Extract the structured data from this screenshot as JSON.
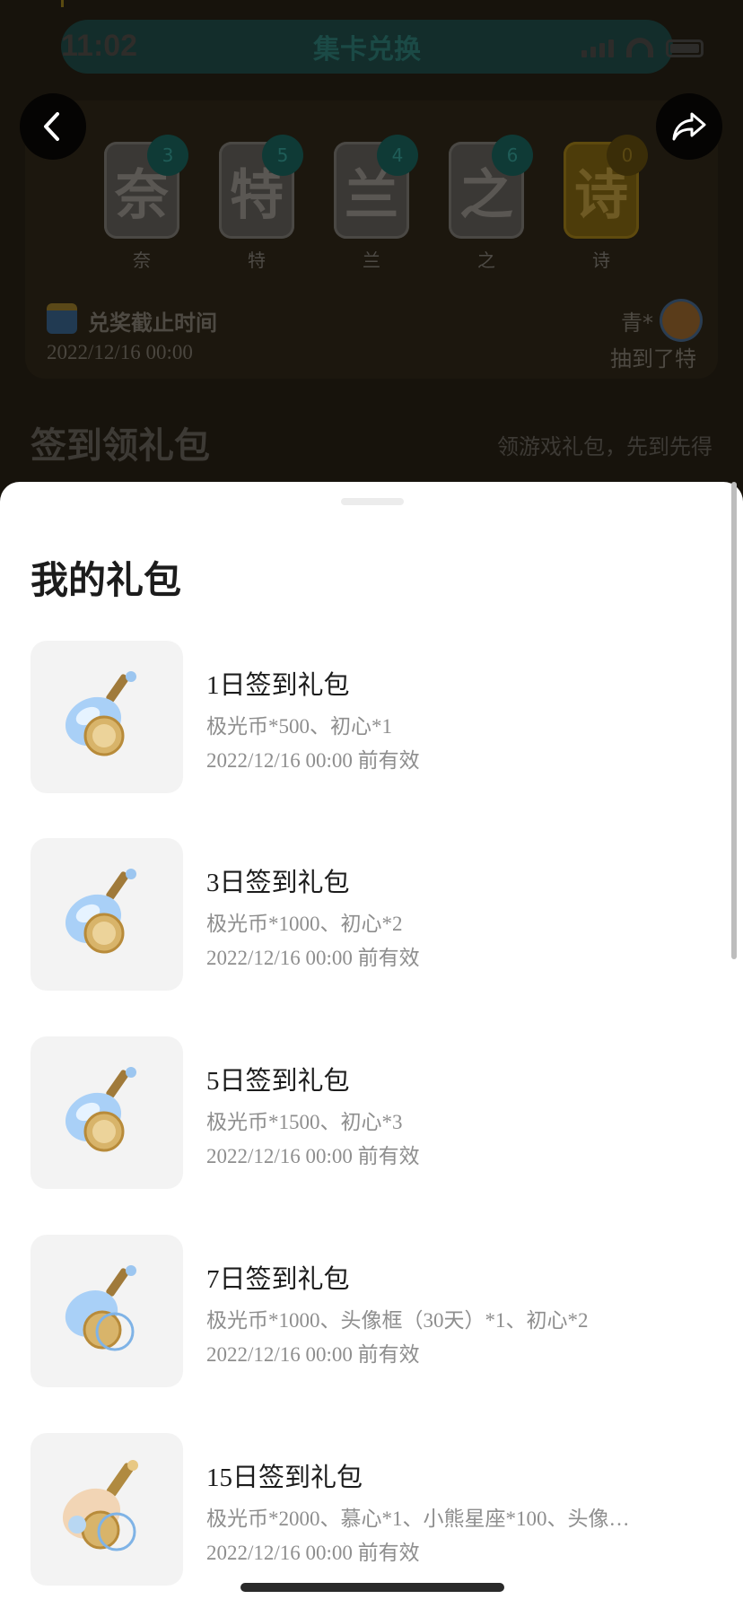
{
  "status_bar": {
    "time": "11:02"
  },
  "header": {
    "title": "集卡兑换"
  },
  "cards": [
    {
      "glyph": "奈",
      "label": "奈",
      "count": "3"
    },
    {
      "glyph": "特",
      "label": "特",
      "count": "5"
    },
    {
      "glyph": "兰",
      "label": "兰",
      "count": "4"
    },
    {
      "glyph": "之",
      "label": "之",
      "count": "6"
    },
    {
      "glyph": "诗",
      "label": "诗",
      "count": "0"
    }
  ],
  "deadline": {
    "label": "兑奖截止时间",
    "value": "2022/12/16 00:00"
  },
  "winner": {
    "name": "青*",
    "desc": "抽到了特"
  },
  "section": {
    "title": "签到领礼包",
    "subtitle": "领游戏礼包，先到先得"
  },
  "sheet": {
    "title": "我的礼包",
    "gifts": [
      {
        "name": "1日签到礼包",
        "contents": "极光币*500、初心*1",
        "expiry": "2022/12/16 00:00 前有效"
      },
      {
        "name": "3日签到礼包",
        "contents": "极光币*1000、初心*2",
        "expiry": "2022/12/16 00:00 前有效"
      },
      {
        "name": "5日签到礼包",
        "contents": "极光币*1500、初心*3",
        "expiry": "2022/12/16 00:00 前有效"
      },
      {
        "name": "7日签到礼包",
        "contents": "极光币*1000、头像框（30天）*1、初心*2",
        "expiry": "2022/12/16 00:00 前有效"
      },
      {
        "name": "15日签到礼包",
        "contents": "极光币*2000、慕心*1、小熊星座*100、头像…",
        "expiry": "2022/12/16 00:00 前有效"
      }
    ]
  },
  "icons": {
    "back": "chevron-left-icon",
    "share": "share-arrow-icon",
    "gift": "potion-bottle-coin-icon"
  }
}
